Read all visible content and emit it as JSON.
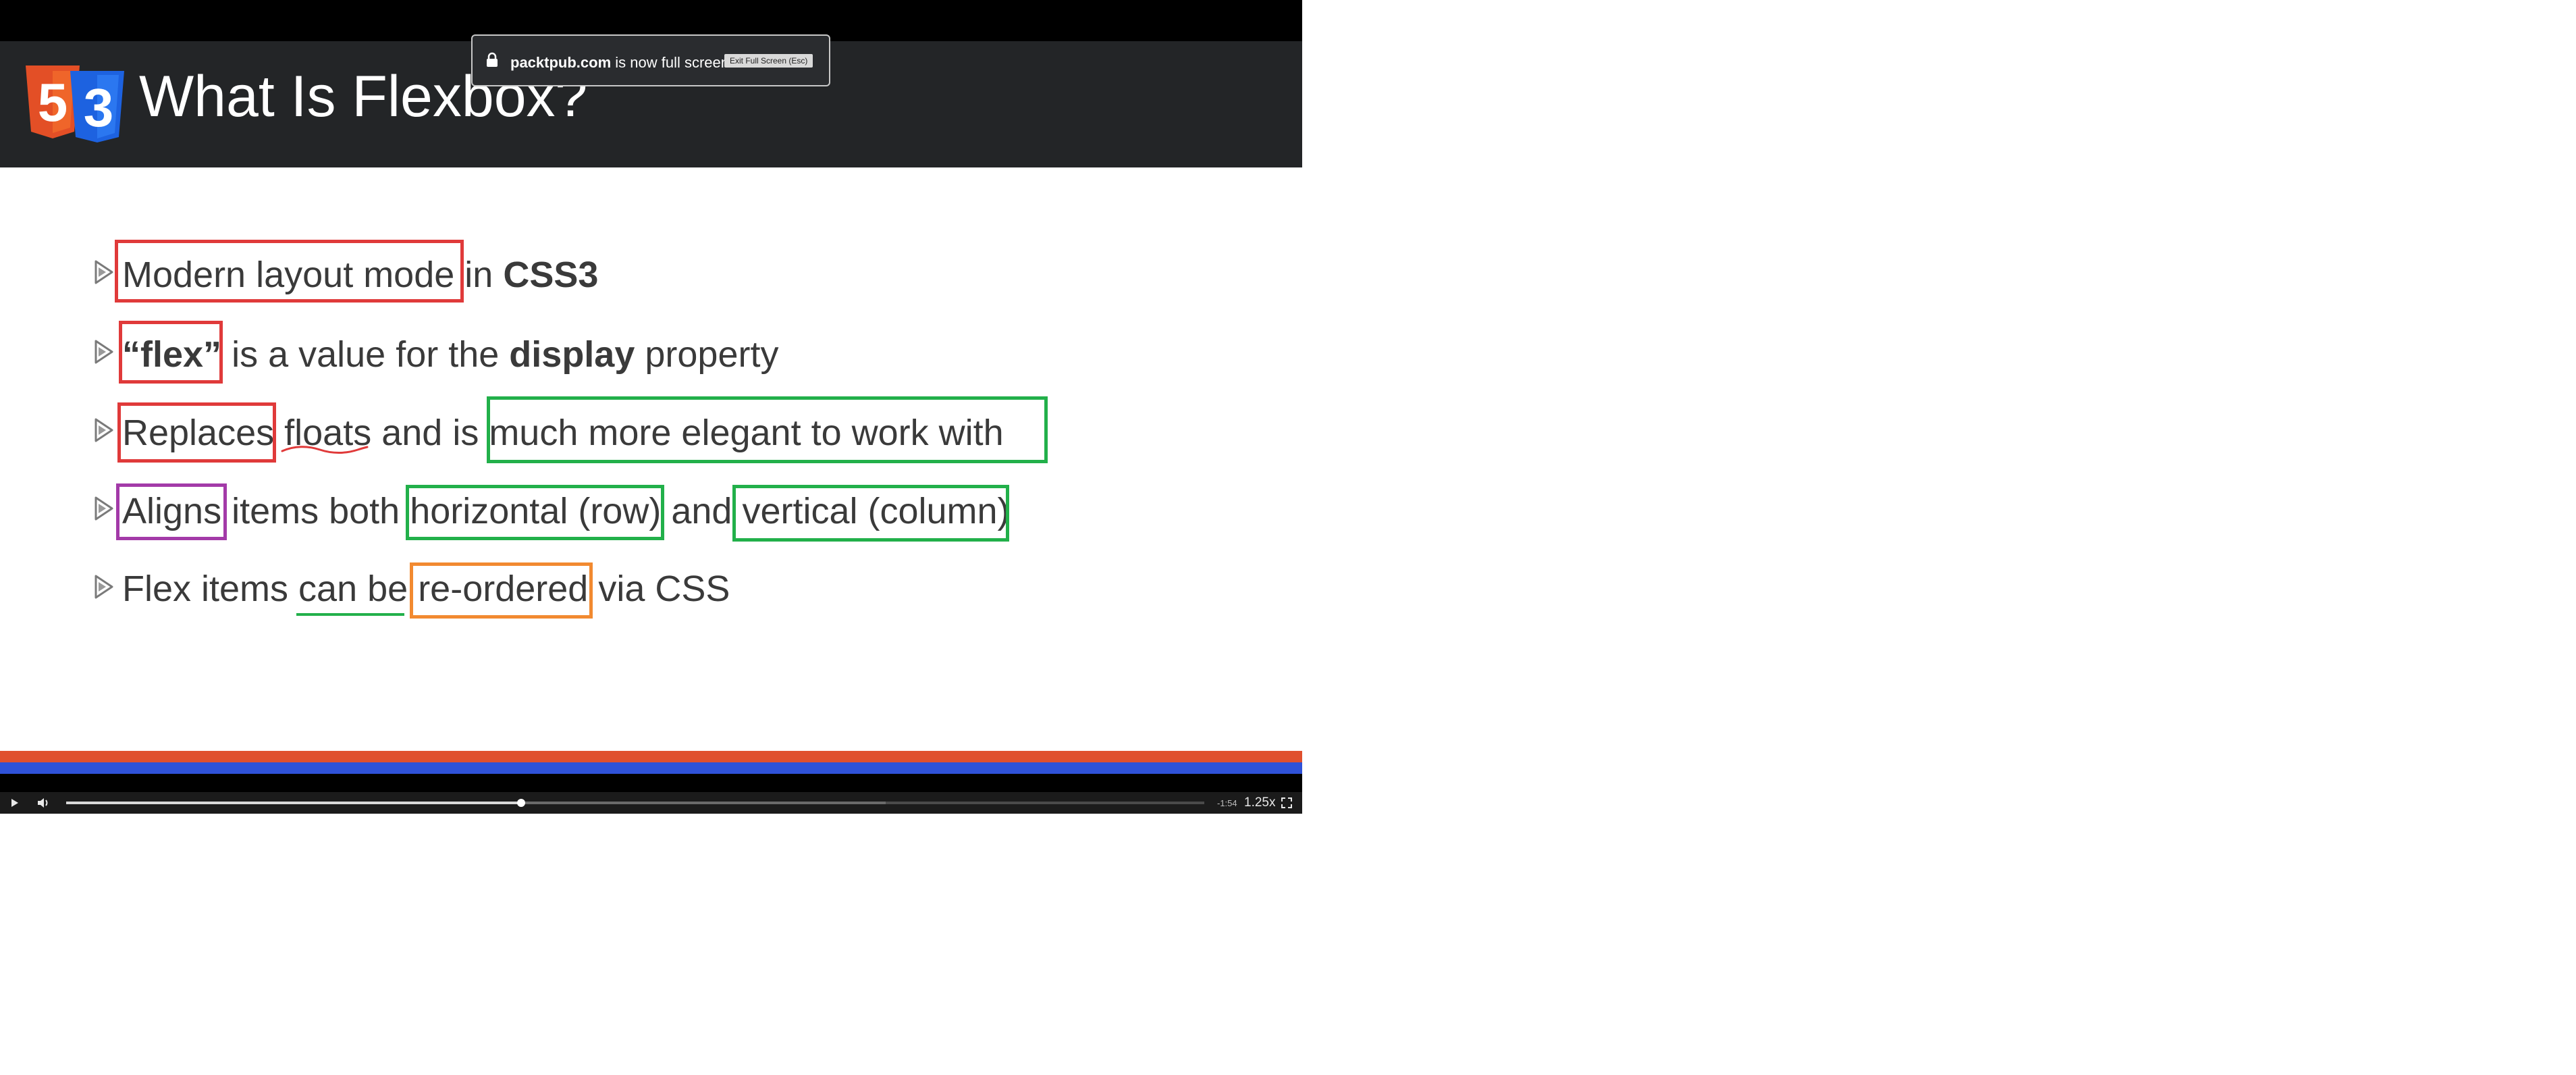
{
  "slide": {
    "title": "What Is Flexbox?",
    "logo": {
      "icon": "html5-css3-logo",
      "colors": {
        "html5": "#e34f26",
        "css3": "#1d62e0"
      }
    },
    "bullets": [
      {
        "parts": [
          "Modern layout mode",
          " in ",
          "CSS3"
        ]
      },
      {
        "parts": [
          "“flex”",
          " is a value for the ",
          "display",
          " property"
        ]
      },
      {
        "parts": [
          "Replaces",
          " ",
          "floats",
          " and  is ",
          "much more elegant to work with"
        ]
      },
      {
        "parts": [
          "Aligns",
          " items both ",
          "horizontal (row)",
          " and ",
          "vertical (column)"
        ]
      },
      {
        "parts": [
          "Flex items ",
          "can be",
          " ",
          "re-ordered",
          " via CSS"
        ]
      }
    ],
    "annotation_colors": {
      "red": "#e03a3a",
      "green": "#22b04a",
      "purple": "#a33aa8",
      "orange": "#f28a30"
    },
    "footer_colors": [
      "#e0502e",
      "#2f52d8"
    ]
  },
  "fullscreen_notice": {
    "domain": "packtpub.com",
    "message": " is now full screen",
    "exit_label": "Exit Full Screen (Esc)"
  },
  "player": {
    "time_remaining": "-1:54",
    "speed": "1.25x",
    "progress": 0.4,
    "buffered": 0.72
  }
}
